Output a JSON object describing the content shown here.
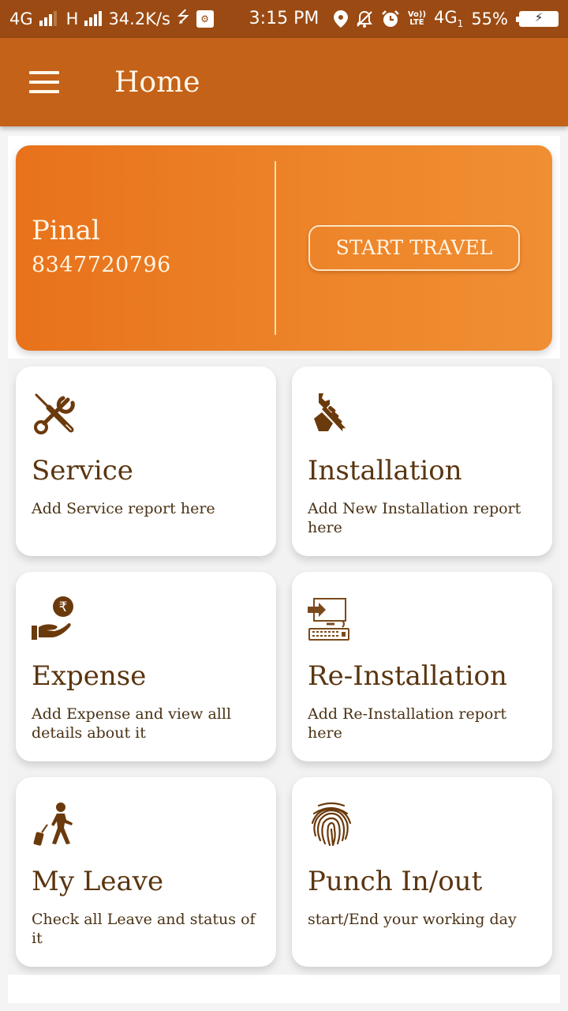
{
  "status_bar": {
    "network1": "4G",
    "network2": "H",
    "speed": "34.2K/s",
    "time": "3:15 PM",
    "volte_top": "Vo))",
    "volte_bottom": "LTE",
    "network3": "4G",
    "network3_sub": "1",
    "battery_percent": "55%",
    "icons": [
      "usb-icon",
      "usb-debug-icon",
      "location-icon",
      "notifications-off-icon",
      "alarm-icon",
      "battery-charging-icon"
    ]
  },
  "app_bar": {
    "title": "Home",
    "menu_icon": "hamburger-menu-icon"
  },
  "profile": {
    "name": "Pinal",
    "phone": "8347720796",
    "start_travel_label": "START TRAVEL"
  },
  "tiles": [
    {
      "icon": "tools-icon",
      "title": "Service",
      "description": "Add Service report here"
    },
    {
      "icon": "wrench-hand-icon",
      "title": "Installation",
      "description": "Add New Installation report here"
    },
    {
      "icon": "rupee-hand-icon",
      "title": "Expense",
      "description": "Add Expense and view alll details about it"
    },
    {
      "icon": "computer-login-icon",
      "title": "Re-Installation",
      "description": "Add Re-Installation report here"
    },
    {
      "icon": "walking-luggage-icon",
      "title": "My Leave",
      "description": "Check all Leave and status of it"
    },
    {
      "icon": "fingerprint-icon",
      "title": "Punch In/out",
      "description": "start/End your working day"
    }
  ],
  "colors": {
    "status_bar": "#9a4a12",
    "app_bar": "#c46219",
    "card_gradient_start": "#e8721b",
    "card_gradient_end": "#f08e33",
    "icon_brown": "#6b3a0c",
    "title_brown": "#5a3510"
  }
}
